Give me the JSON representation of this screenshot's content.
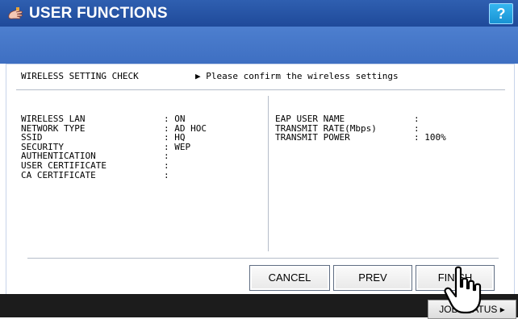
{
  "window": {
    "title": "USER FUNCTIONS",
    "help_label": "?"
  },
  "screen": {
    "heading": "WIRELESS SETTING CHECK",
    "instruction": "▶ Please confirm the wireless settings"
  },
  "left_settings": [
    {
      "label": "WIRELESS LAN",
      "value": ": ON"
    },
    {
      "label": "NETWORK TYPE",
      "value": ": AD HOC"
    },
    {
      "label": "SSID",
      "value": ": HQ"
    },
    {
      "label": "SECURITY",
      "value": ": WEP"
    },
    {
      "label": "AUTHENTICATION",
      "value": ":"
    },
    {
      "label": "USER CERTIFICATE",
      "value": ":"
    },
    {
      "label": "CA CERTIFICATE",
      "value": ":"
    }
  ],
  "right_settings": [
    {
      "label": "EAP USER NAME",
      "value": ":"
    },
    {
      "label": "TRANSMIT RATE(Mbps)",
      "value": ":"
    },
    {
      "label": "TRANSMIT POWER",
      "value": ": 100%"
    }
  ],
  "buttons": {
    "cancel": "CANCEL",
    "prev": "PREV",
    "finish": "FINISH"
  },
  "footer": {
    "job_status": "JOB STATUS ▸"
  },
  "colors": {
    "titlebar": "#2f5fb0",
    "subbar": "#4d7fcf",
    "help": "#1893d3",
    "footer": "#1c1c1c"
  },
  "icons": [
    "function-hand-icon",
    "pointer-hand-icon"
  ]
}
